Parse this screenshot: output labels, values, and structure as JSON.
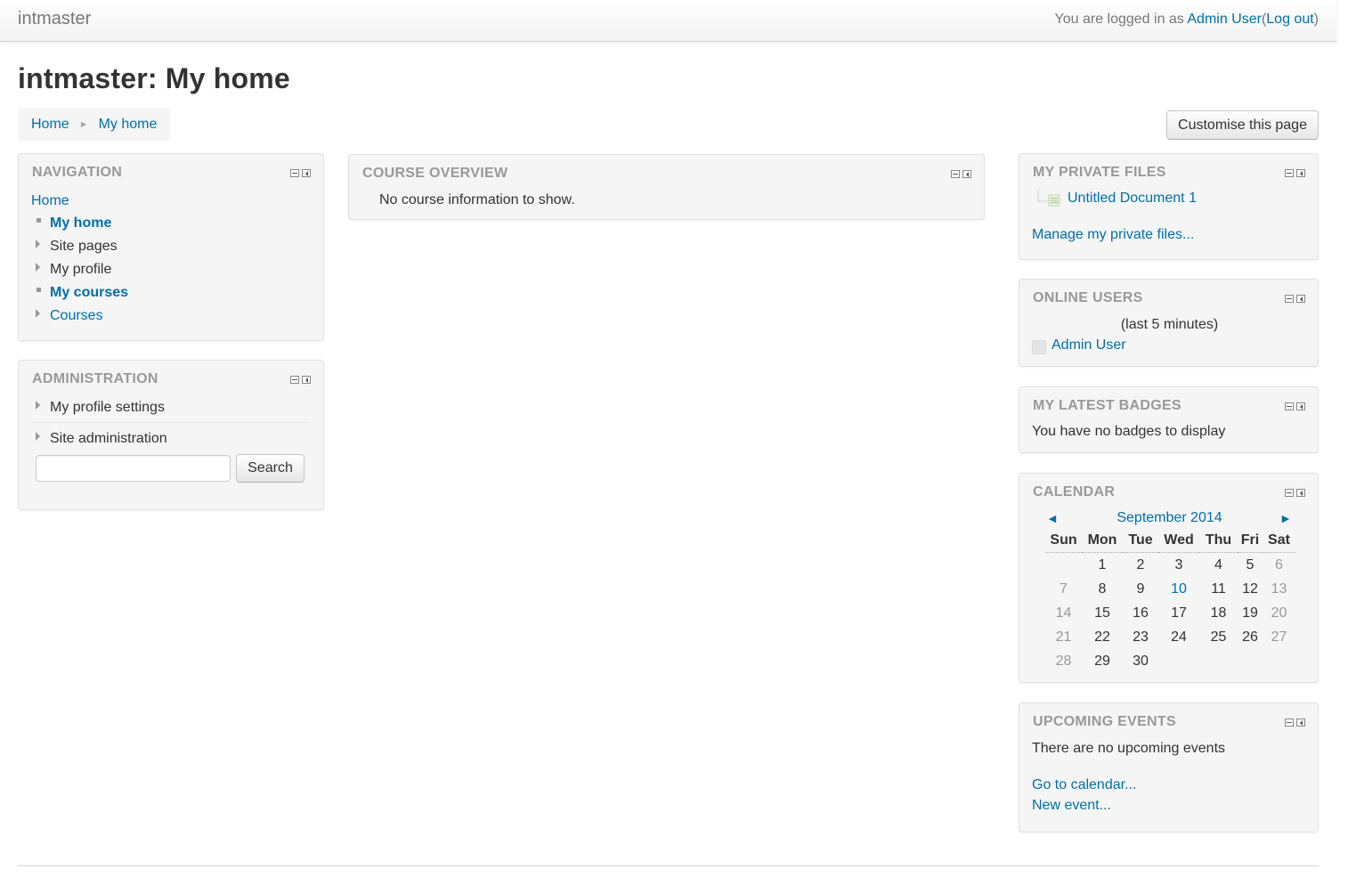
{
  "navbar": {
    "brand": "intmaster",
    "logged_in_prefix": "You are logged in as ",
    "user_name": "Admin User",
    "logout_label": "Log out"
  },
  "page": {
    "title": "intmaster: My home"
  },
  "breadcrumb": {
    "items": [
      "Home",
      "My home"
    ]
  },
  "customise_button": "Customise this page",
  "navigation": {
    "title": "NAVIGATION",
    "home": "Home",
    "items": [
      "My home",
      "Site pages",
      "My profile",
      "My courses",
      "Courses"
    ]
  },
  "administration": {
    "title": "ADMINISTRATION",
    "items": [
      "My profile settings",
      "Site administration"
    ],
    "search_button": "Search",
    "search_value": ""
  },
  "course_overview": {
    "title": "COURSE OVERVIEW",
    "message": "No course information to show."
  },
  "private_files": {
    "title": "MY PRIVATE FILES",
    "file": "Untitled Document 1",
    "manage_link": "Manage my private files..."
  },
  "online_users": {
    "title": "ONLINE USERS",
    "period": "(last 5 minutes)",
    "user": "Admin User"
  },
  "latest_badges": {
    "title": "MY LATEST BADGES",
    "message": "You have no badges to display"
  },
  "calendar": {
    "title": "CALENDAR",
    "prev": "◄",
    "next": "►",
    "month": "September 2014",
    "weekdays": [
      "Sun",
      "Mon",
      "Tue",
      "Wed",
      "Thu",
      "Fri",
      "Sat"
    ],
    "weeks": [
      [
        "",
        "1",
        "2",
        "3",
        "4",
        "5",
        "6"
      ],
      [
        "7",
        "8",
        "9",
        "10",
        "11",
        "12",
        "13"
      ],
      [
        "14",
        "15",
        "16",
        "17",
        "18",
        "19",
        "20"
      ],
      [
        "21",
        "22",
        "23",
        "24",
        "25",
        "26",
        "27"
      ],
      [
        "28",
        "29",
        "30",
        "",
        "",
        "",
        ""
      ]
    ],
    "event_days": [
      "10"
    ],
    "colors": {
      "weekend": "#999999",
      "event": "#0070a8"
    }
  },
  "upcoming_events": {
    "title": "UPCOMING EVENTS",
    "message": "There are no upcoming events",
    "calendar_link": "Go to calendar...",
    "new_event_link": "New event..."
  },
  "theme": {
    "link_color": "#0070a8",
    "block_bg": "#f5f5f5",
    "title_gray": "#999999"
  }
}
